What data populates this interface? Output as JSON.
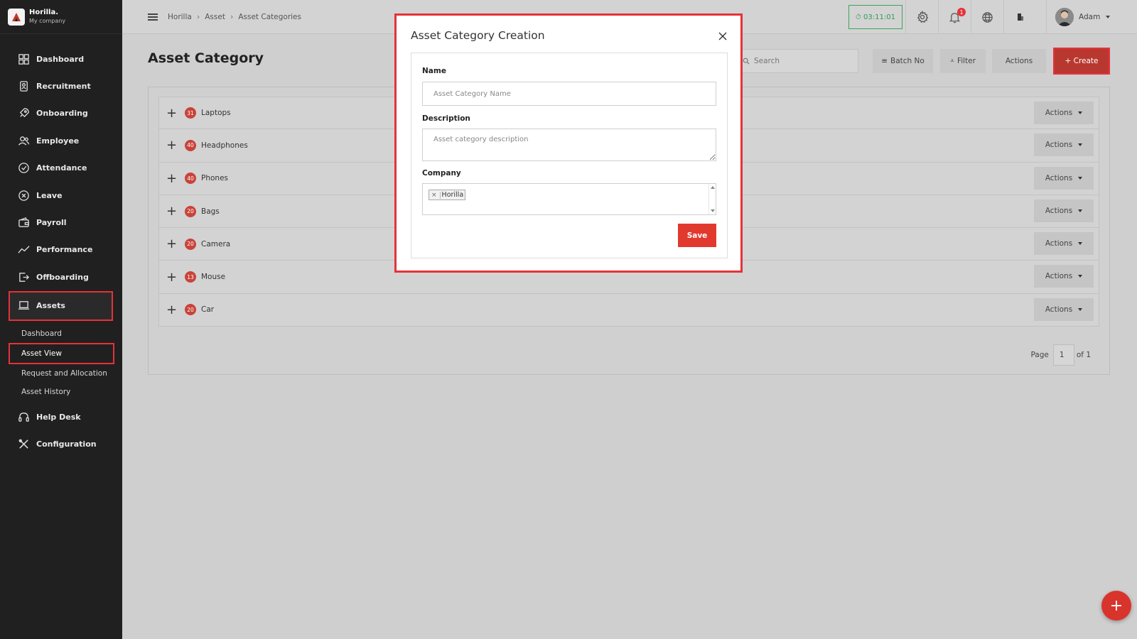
{
  "brand": {
    "name": "Horilla.",
    "subtitle": "My company"
  },
  "sidebar": {
    "items": [
      {
        "label": "Dashboard",
        "icon": "dashboard-icon"
      },
      {
        "label": "Recruitment",
        "icon": "recruitment-icon"
      },
      {
        "label": "Onboarding",
        "icon": "rocket-icon"
      },
      {
        "label": "Employee",
        "icon": "employee-icon"
      },
      {
        "label": "Attendance",
        "icon": "attendance-icon"
      },
      {
        "label": "Leave",
        "icon": "leave-icon"
      },
      {
        "label": "Payroll",
        "icon": "wallet-icon"
      },
      {
        "label": "Performance",
        "icon": "chart-line-icon"
      },
      {
        "label": "Offboarding",
        "icon": "exit-icon"
      },
      {
        "label": "Assets",
        "icon": "laptop-icon"
      }
    ],
    "asset_submenu": [
      "Dashboard",
      "Asset View",
      "Request and Allocation",
      "Asset History"
    ],
    "bottom_items": [
      {
        "label": "Help Desk",
        "icon": "headset-icon"
      },
      {
        "label": "Configuration",
        "icon": "tools-icon"
      }
    ]
  },
  "topbar": {
    "breadcrumbs": [
      "Horilla",
      "Asset",
      "Asset Categories"
    ],
    "timer": "⏱ 03:11:01",
    "notification_count": "1",
    "user_name": "Adam"
  },
  "page": {
    "title": "Asset Category",
    "search_placeholder": "Search",
    "batch_label": "Batch No",
    "filter_label": "Filter",
    "actions_label": "Actions",
    "create_label": "+ Create"
  },
  "categories": [
    {
      "count": "31",
      "name": "Laptops"
    },
    {
      "count": "40",
      "name": "Headphones"
    },
    {
      "count": "40",
      "name": "Phones"
    },
    {
      "count": "20",
      "name": "Bags"
    },
    {
      "count": "20",
      "name": "Camera"
    },
    {
      "count": "13",
      "name": "Mouse"
    },
    {
      "count": "20",
      "name": "Car"
    }
  ],
  "row_actions_label": "Actions",
  "pagination": {
    "page_label": "Page",
    "current": "1",
    "of_label": "of 1"
  },
  "modal": {
    "title": "Asset Category Creation",
    "name_label": "Name",
    "name_placeholder": "Asset Category Name",
    "description_label": "Description",
    "description_placeholder": "Asset category description",
    "company_label": "Company",
    "company_chip": "Horilla",
    "save_label": "Save"
  },
  "colors": {
    "accent": "#e5323a",
    "sidebar_bg": "#202020",
    "success": "#3aa55a"
  }
}
